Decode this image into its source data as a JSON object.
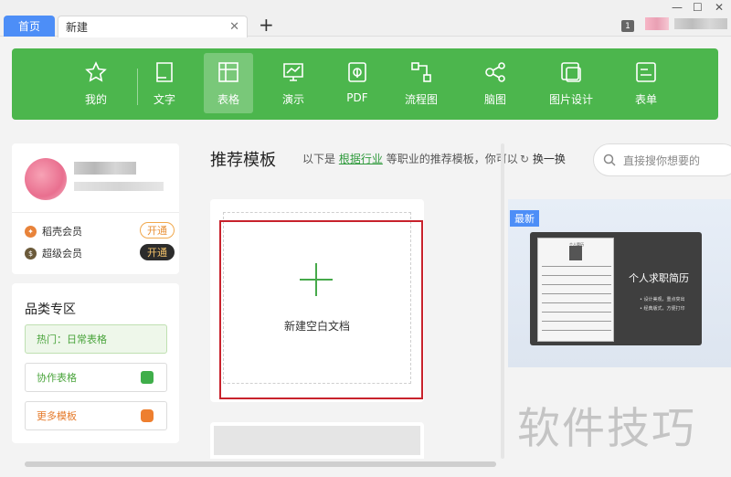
{
  "tabs": {
    "home": "首页",
    "new": "新建"
  },
  "window": {
    "badge": "1"
  },
  "toolbar": {
    "items": [
      {
        "label": "我的",
        "icon": "star-icon"
      },
      {
        "label": "文字",
        "icon": "document-icon"
      },
      {
        "label": "表格",
        "icon": "table-icon",
        "active": true
      },
      {
        "label": "演示",
        "icon": "presentation-icon"
      },
      {
        "label": "PDF",
        "icon": "pdf-icon"
      },
      {
        "label": "流程图",
        "icon": "flowchart-icon"
      },
      {
        "label": "脑图",
        "icon": "mindmap-icon"
      },
      {
        "label": "图片设计",
        "icon": "image-design-icon"
      },
      {
        "label": "表单",
        "icon": "form-icon"
      }
    ],
    "color": "#4cb64d"
  },
  "membership": [
    {
      "label": "稻壳会员",
      "button": "开通",
      "icon_color": "#e8833a"
    },
    {
      "label": "超级会员",
      "button": "开通",
      "icon_color": "#6b5a3a"
    }
  ],
  "category": {
    "title": "品类专区",
    "items": [
      {
        "label": "热门：日常表格"
      },
      {
        "label": "协作表格"
      },
      {
        "label": "更多模板"
      }
    ]
  },
  "main": {
    "title": "推荐模板",
    "desc_prefix": "以下是",
    "desc_link": "根据行业",
    "desc_suffix": "等职业的推荐模板，你可以",
    "refresh": "换一换",
    "search_placeholder": "直接搜你想要的",
    "new_blank": "新建空白文档"
  },
  "template": {
    "badge": "最新",
    "resume_header": "个人简历",
    "title": "个人求职简历",
    "bullets": [
      "设计美观，重点突出",
      "经典版式，方便打印"
    ]
  },
  "watermark": "软件技巧",
  "colors": {
    "accent": "#4cb64d",
    "tab_blue": "#4d8ef7",
    "highlight_red": "#c8222c"
  }
}
